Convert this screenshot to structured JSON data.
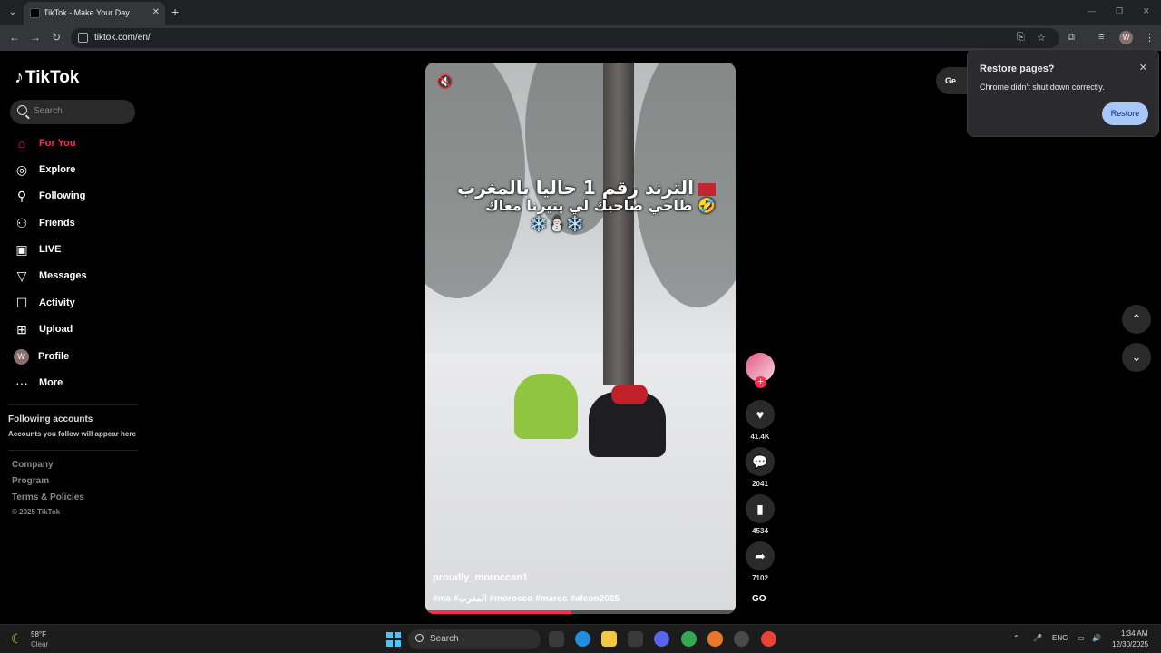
{
  "browser": {
    "tab_title": "TikTok - Make Your Day",
    "url": "tiktok.com/en/",
    "profile_initial": "W"
  },
  "sidebar": {
    "logo": "TikTok",
    "search_placeholder": "Search",
    "nav": [
      {
        "label": "For You",
        "icon": "home-icon",
        "active": true
      },
      {
        "label": "Explore",
        "icon": "compass-icon"
      },
      {
        "label": "Following",
        "icon": "person-icon"
      },
      {
        "label": "Friends",
        "icon": "people-icon"
      },
      {
        "label": "LIVE",
        "icon": "live-icon"
      },
      {
        "label": "Messages",
        "icon": "send-icon"
      },
      {
        "label": "Activity",
        "icon": "activity-icon"
      },
      {
        "label": "Upload",
        "icon": "upload-icon"
      },
      {
        "label": "Profile",
        "icon": "avatar"
      },
      {
        "label": "More",
        "icon": "more-icon"
      }
    ],
    "profile_initial": "W",
    "following_accounts_title": "Following accounts",
    "following_accounts_sub": "Accounts you follow will appear here",
    "footer_links": [
      "Company",
      "Program",
      "Terms & Policies"
    ],
    "copyright": "© 2025 TikTok"
  },
  "video": {
    "caption_line1": "الترند رقم 1 حاليا بالمغرب",
    "caption_line2": "طاحي صاحبك لي يتيرنا معاك 🤣",
    "snow_emoji": "❄️⛄❄️",
    "username": "proudly_moroccan1",
    "hashtags": "#ma #المغرب #morocco #maroc #afcon2025",
    "progress": 0.47
  },
  "actions": {
    "likes": "41.4K",
    "comments": "2041",
    "saves": "4534",
    "shares": "7102",
    "music_label": "GO"
  },
  "get_app_label": "Ge",
  "restore_popup": {
    "title": "Restore pages?",
    "message": "Chrome didn't shut down correctly.",
    "button": "Restore"
  },
  "taskbar": {
    "weather_temp": "58°F",
    "weather_desc": "Clear",
    "search_label": "Search",
    "lang": "ENG",
    "time": "1:34 AM",
    "date": "12/30/2025"
  }
}
